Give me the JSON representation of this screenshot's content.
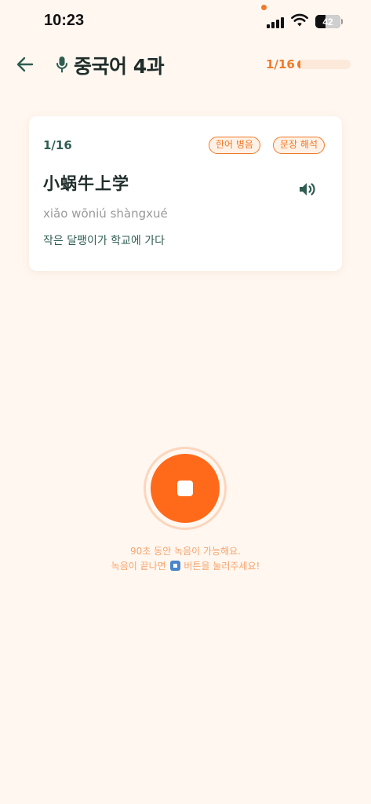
{
  "status_bar": {
    "time": "10:23",
    "battery": "42",
    "icons": [
      "signal-icon",
      "wifi-icon",
      "battery-icon"
    ]
  },
  "header": {
    "back_icon": "arrow-left-icon",
    "title_icon": "mic-icon",
    "title": "중국어 4과",
    "progress_text": "1/16",
    "progress_fraction": 0.0625
  },
  "card": {
    "index": "1/16",
    "tags": [
      "한어 병음",
      "문장 해석"
    ],
    "hanzi": "小蜗牛上学",
    "pinyin": "xiǎo wōniú shàngxué",
    "korean": "작은 달팽이가 학교에 가다",
    "speaker_icon": "speaker-icon"
  },
  "recorder": {
    "stop_icon": "stop-icon",
    "hint_line1": "90초 동안 녹음이 가능해요.",
    "hint_line2_before": "녹음이 끝나면",
    "hint_line2_after": "버튼을 눌러주세요!"
  },
  "colors": {
    "background": "#fff7f0",
    "accent": "#f07a2a",
    "record_button": "#ff6a1a",
    "primary_text": "#1f2d2a",
    "green_text": "#2f5d52"
  }
}
